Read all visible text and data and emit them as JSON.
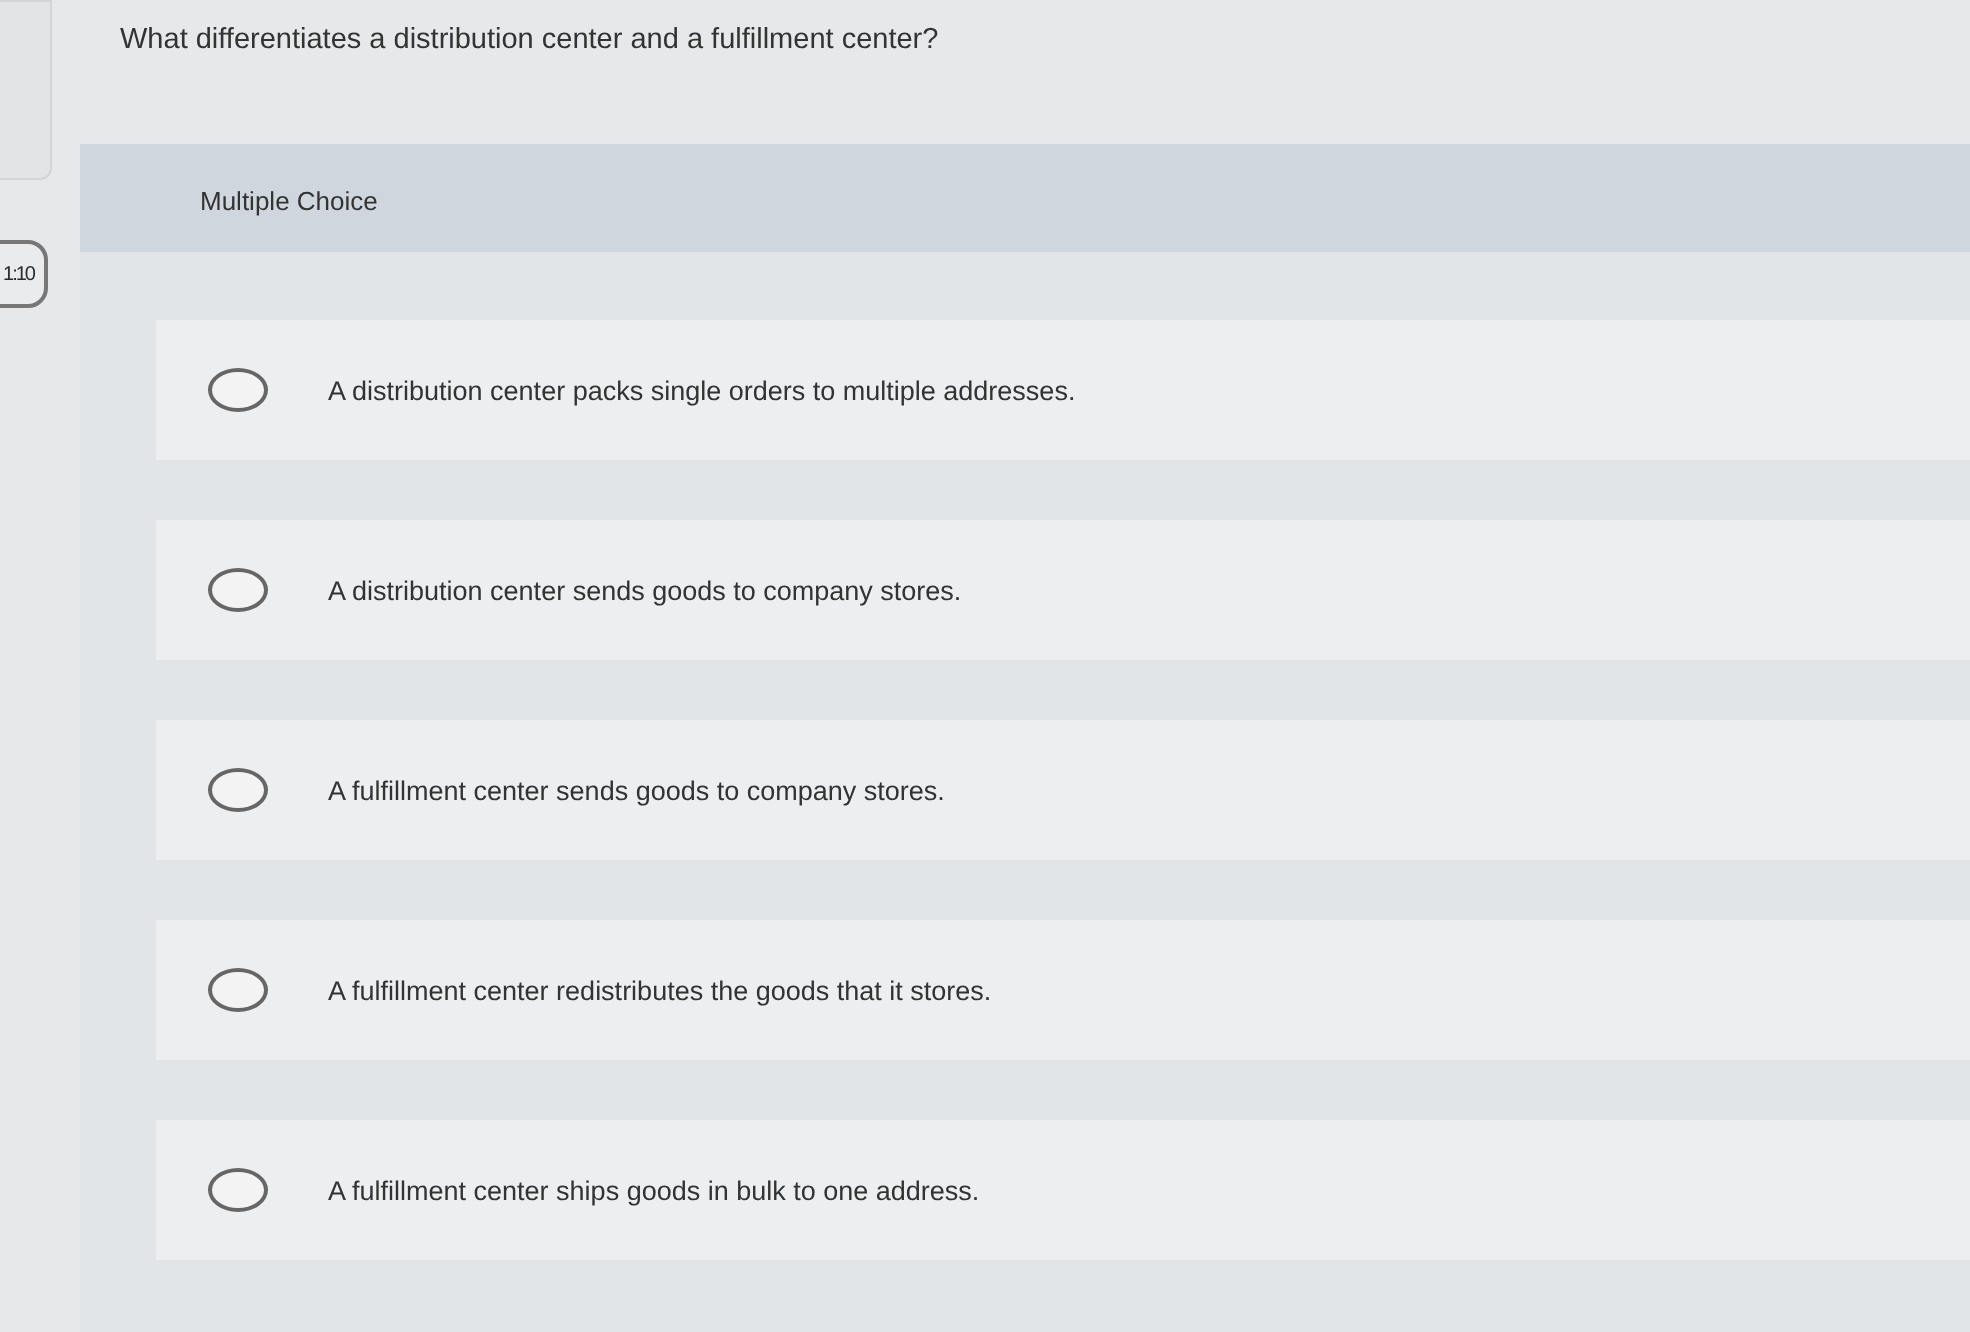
{
  "question_number_badge": "1:10",
  "question": "What differentiates a distribution center and a fulfillment center?",
  "answer_type": "Multiple Choice",
  "options": [
    {
      "label": "A distribution center packs single orders to multiple addresses.",
      "selected": false
    },
    {
      "label": "A distribution center sends goods to company stores.",
      "selected": false
    },
    {
      "label": "A fulfillment center sends goods to company stores.",
      "selected": false
    },
    {
      "label": "A fulfillment center redistributes the goods that it stores.",
      "selected": false
    },
    {
      "label": "A fulfillment center ships goods in bulk to one address.",
      "selected": false
    }
  ]
}
